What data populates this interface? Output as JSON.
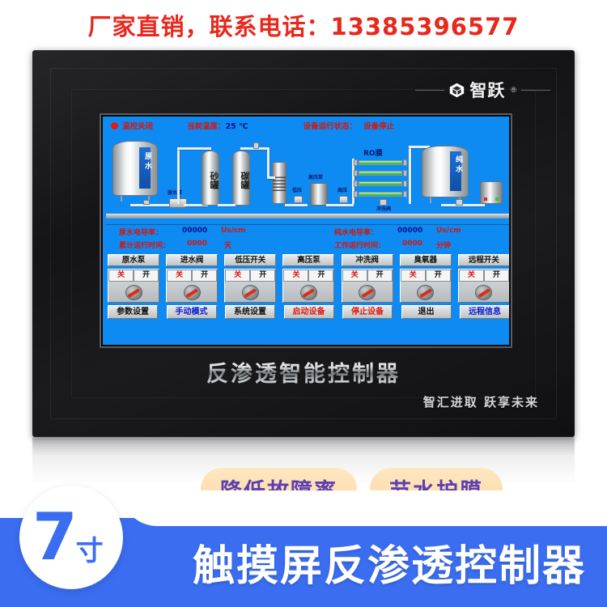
{
  "promo": {
    "text": "厂家直销，联系电话：13385396577",
    "color": "#e8281c"
  },
  "device": {
    "brand": "智跃",
    "brand_reg": "®",
    "brand_icon": "cube-logo-icon",
    "product_name": "反渗透智能控制器",
    "tagline": "智汇进取  跃享未来"
  },
  "screen": {
    "background_color": "#0d8bf2",
    "status": {
      "indicator_icon": "red-dot-icon",
      "temp_control": "温控关闭",
      "temp_label": "当前温度：",
      "temp_value": "25 ℃",
      "run_state_label": "设备运行状态：",
      "run_state_value": "设备停止"
    },
    "diagram": {
      "raw_tank": "原水",
      "pure_tank": "纯水",
      "raw_pump": "原水泵",
      "sand_tank": "砂罐",
      "carbon_tank": "碳罐",
      "low_pressure": "低压",
      "high_pressure": "高压",
      "hp_pump": "高压泵",
      "ro_membrane": "RO膜",
      "flush_valve": "冲洗阀",
      "ozone": "臭氧器"
    },
    "readouts": [
      {
        "label": "原水电导率：",
        "value": "00000",
        "unit": "Us/cm",
        "value_color": "blue"
      },
      {
        "label": "纯水电导率：",
        "value": "00000",
        "unit": "Us/cm",
        "value_color": "blue"
      },
      {
        "label": "累计运行时间：",
        "value": "0000",
        "unit": "天",
        "value_color": "red"
      },
      {
        "label": "工作运行时间：",
        "value": "0000",
        "unit": "分钟",
        "value_color": "red"
      }
    ],
    "equipment": [
      {
        "label": "原水泵",
        "off": "关",
        "on": "开"
      },
      {
        "label": "进水阀",
        "off": "关",
        "on": "开"
      },
      {
        "label": "低压开关",
        "off": "关",
        "on": "开"
      },
      {
        "label": "高压泵",
        "off": "关",
        "on": "开"
      },
      {
        "label": "冲洗阀",
        "off": "关",
        "on": "开"
      },
      {
        "label": "臭氧器",
        "off": "关",
        "on": "开"
      },
      {
        "label": "远程开关",
        "off": "关",
        "on": "开"
      }
    ],
    "actions": [
      {
        "label": "参数设置",
        "color": "black"
      },
      {
        "label": "手动模式",
        "color": "blue"
      },
      {
        "label": "系统设置",
        "color": "black"
      },
      {
        "label": "启动设备",
        "color": "red"
      },
      {
        "label": "停止设备",
        "color": "red"
      },
      {
        "label": "退出",
        "color": "black"
      },
      {
        "label": "远程信息",
        "color": "blue"
      }
    ]
  },
  "marketing": {
    "pills": [
      "降低故障率",
      "节水护膜"
    ],
    "size_number": "7",
    "size_unit": "寸",
    "bottom_title": "触摸屏反渗透控制器",
    "banner_color": "#3a6df0",
    "pill_text_color": "#5c3fb0"
  }
}
